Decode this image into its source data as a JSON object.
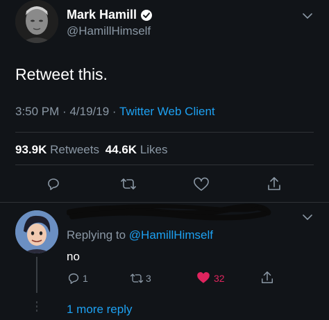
{
  "tweet": {
    "author_name": "Mark Hamill",
    "author_handle": "@HamillHimself",
    "text": "Retweet this.",
    "time": "3:50 PM",
    "date": "4/19/19",
    "separator": "·",
    "source": "Twitter Web Client",
    "stats": {
      "retweets_count": "93.9K",
      "retweets_label": "Retweets",
      "likes_count": "44.6K",
      "likes_label": "Likes"
    }
  },
  "reply": {
    "replying_to_prefix": "Replying to",
    "replying_to_handle": "@HamillHimself",
    "text": "no",
    "reply_count": "1",
    "retweet_count": "3",
    "like_count": "32"
  },
  "thread": {
    "more_replies_label": "1 more reply"
  },
  "colors": {
    "background": "#111418",
    "accent": "#1da1f2",
    "muted": "#8b98a5",
    "like_active": "#e0245e",
    "divider": "#2f3336"
  },
  "icons": [
    "verified-badge-icon",
    "chevron-down-icon",
    "reply-icon",
    "retweet-icon",
    "like-icon",
    "share-icon"
  ]
}
